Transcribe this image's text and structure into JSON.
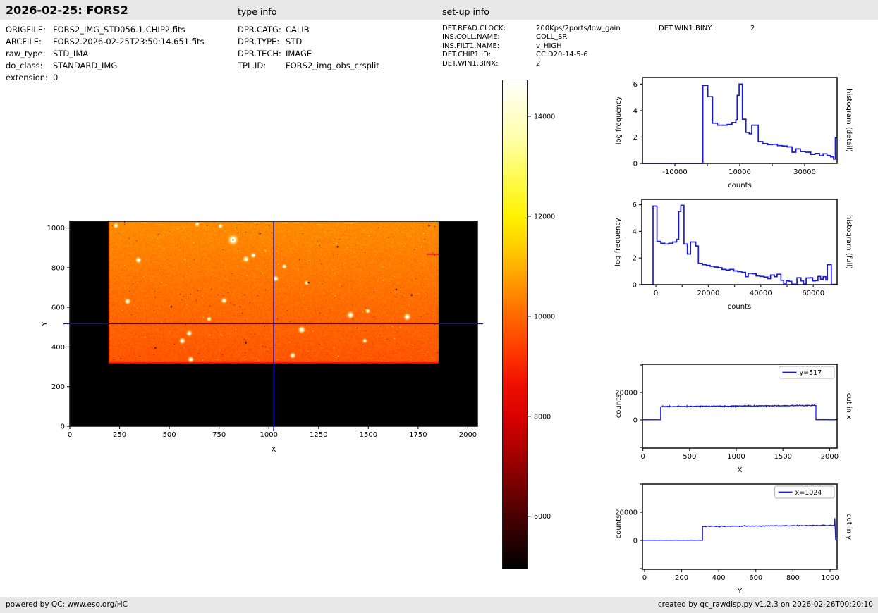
{
  "header": {
    "title": "2026-02-25: FORS2",
    "type_info": "type info",
    "setup_info": "set-up info"
  },
  "file_info": {
    "rows": [
      {
        "label": "ORIGFILE:",
        "value": "FORS2_IMG_STD056.1.CHIP2.fits"
      },
      {
        "label": "ARCFILE:",
        "value": "FORS2.2026-02-25T23:50:14.651.fits"
      },
      {
        "label": "raw_type:",
        "value": "STD_IMA"
      },
      {
        "label": "do_class:",
        "value": "STANDARD_IMG"
      },
      {
        "label": "extension:",
        "value": "0"
      }
    ]
  },
  "type_info": {
    "rows": [
      {
        "label": "DPR.CATG:",
        "value": "CALIB"
      },
      {
        "label": "DPR.TYPE:",
        "value": "STD"
      },
      {
        "label": "DPR.TECH:",
        "value": "IMAGE"
      },
      {
        "label": "TPL.ID:",
        "value": "FORS2_img_obs_crsplit"
      }
    ]
  },
  "setup_info": {
    "rows": [
      {
        "label": "DET.READ.CLOCK:",
        "value": "200Kps/2ports/low_gain"
      },
      {
        "label": "INS.COLL.NAME:",
        "value": "COLL_SR"
      },
      {
        "label": "INS.FILT1.NAME:",
        "value": "v_HIGH"
      },
      {
        "label": "DET.CHIP1.ID:",
        "value": "CCID20-14-5-6"
      },
      {
        "label": "DET.WIN1.BINX:",
        "value": "2"
      }
    ],
    "rows_col2": [
      {
        "label": "DET.WIN1.BINY:",
        "value": "2"
      }
    ]
  },
  "footer": {
    "left": "powered by QC: www.eso.org/HC",
    "right": "created by qc_rawdisp.py v1.2.3 on 2026-02-26T00:20:10"
  },
  "colors": {
    "line_blue": "#1a1adc",
    "crosshair_blue": "#0000ff",
    "frame": "#1a1a1a",
    "header_bg": "#e8e8e8",
    "image_orange": "#ff6a00",
    "trail_red": "#d40000",
    "legend_border": "#b0b0b0"
  },
  "chart_data": [
    {
      "id": "main_image",
      "type": "heatmap",
      "xlabel": "X",
      "ylabel": "Y",
      "xlim": [
        0,
        2048
      ],
      "ylim": [
        0,
        1034
      ],
      "xticks": [
        0,
        250,
        500,
        750,
        1000,
        1250,
        1500,
        1750,
        2000
      ],
      "yticks": [
        0,
        200,
        400,
        600,
        800,
        1000
      ],
      "crosshair": {
        "x": 1024,
        "y": 517
      },
      "illuminated_region": {
        "x0": 195,
        "x1": 1852,
        "y0": 318,
        "y1": 1034
      },
      "counts_levels": {
        "plateau_bottom": 9700,
        "plateau_top": 10500,
        "vmin": 4940,
        "vmax": 14730
      },
      "stars": [
        [
          820,
          940,
          3
        ],
        [
          345,
          838,
          1.5
        ],
        [
          885,
          843,
          1.5
        ],
        [
          922,
          862,
          1.2
        ],
        [
          1078,
          806,
          1
        ],
        [
          1035,
          745,
          1.3
        ],
        [
          1190,
          723,
          1
        ],
        [
          290,
          630,
          1.4
        ],
        [
          775,
          634,
          1.3
        ],
        [
          700,
          541,
          1
        ],
        [
          1410,
          561,
          1.8
        ],
        [
          1695,
          552,
          1.8
        ],
        [
          1497,
          581,
          1
        ],
        [
          1165,
          487,
          1.8
        ],
        [
          600,
          469,
          1.4
        ],
        [
          565,
          431,
          1.5
        ],
        [
          1482,
          431,
          1
        ],
        [
          1120,
          357,
          1.3
        ],
        [
          608,
          337,
          1.4
        ],
        [
          232,
          1012,
          1.2
        ],
        [
          640,
          1018,
          1
        ],
        [
          757,
          1010,
          1
        ]
      ],
      "dark_specks": [
        [
          1805,
          1012
        ],
        [
          1640,
          690
        ],
        [
          1200,
          725
        ],
        [
          430,
          395
        ],
        [
          955,
          972
        ],
        [
          1718,
          662
        ],
        [
          1345,
          905
        ],
        [
          510,
          603
        ],
        [
          885,
          420
        ]
      ],
      "red_trail": {
        "y": 868,
        "x0": 1792,
        "x1": 1860
      }
    },
    {
      "id": "colorbar",
      "type": "colorbar",
      "colormap": "hot",
      "vmin": 4940,
      "vmax": 14730,
      "ticks": [
        14000,
        12000,
        10000,
        8000,
        6000
      ]
    },
    {
      "id": "hist_detail",
      "type": "step-histogram",
      "right_label": "histogram (detail)",
      "xlabel": "counts",
      "ylabel": "log frequency",
      "xlim": [
        -20000,
        40000
      ],
      "ylim": [
        0,
        6.5
      ],
      "xticks": [
        [
          -10000,
          "-10000"
        ],
        [
          0,
          null
        ],
        [
          10000,
          "10000"
        ],
        [
          20000,
          null
        ],
        [
          30000,
          "30000"
        ]
      ],
      "yticks": [
        [
          0,
          "0"
        ],
        [
          2,
          "2"
        ],
        [
          4,
          "4"
        ],
        [
          6,
          "6"
        ]
      ],
      "steps": [
        [
          -20000,
          0
        ],
        [
          -1400,
          5.9
        ],
        [
          150,
          5.05
        ],
        [
          1600,
          3.05
        ],
        [
          3100,
          2.9
        ],
        [
          4600,
          2.9
        ],
        [
          6100,
          2.95
        ],
        [
          7600,
          3.1
        ],
        [
          8800,
          3.3
        ],
        [
          9200,
          5.15
        ],
        [
          9800,
          6.0
        ],
        [
          10800,
          3.35
        ],
        [
          11900,
          2.35
        ],
        [
          12900,
          2.25
        ],
        [
          13700,
          2.9
        ],
        [
          15700,
          1.65
        ],
        [
          17100,
          1.5
        ],
        [
          18600,
          1.42
        ],
        [
          20100,
          1.45
        ],
        [
          21600,
          1.35
        ],
        [
          23100,
          1.32
        ],
        [
          24600,
          1.25
        ],
        [
          26100,
          0.85
        ],
        [
          27300,
          1.1
        ],
        [
          28700,
          0.9
        ],
        [
          30300,
          0.85
        ],
        [
          31900,
          0.68
        ],
        [
          33200,
          0.75
        ],
        [
          34600,
          0.58
        ],
        [
          35700,
          0.73
        ],
        [
          36900,
          0.6
        ],
        [
          38000,
          0.5
        ],
        [
          38900,
          0.33
        ],
        [
          39450,
          1.95
        ]
      ]
    },
    {
      "id": "hist_full",
      "type": "step-histogram",
      "right_label": "histogram (full)",
      "xlabel": "counts",
      "ylabel": "log frequency",
      "xlim": [
        -5400,
        69100
      ],
      "ylim": [
        0,
        6.4
      ],
      "xticks": [
        [
          0,
          "0"
        ],
        [
          10000,
          null
        ],
        [
          20000,
          "20000"
        ],
        [
          30000,
          null
        ],
        [
          40000,
          "40000"
        ],
        [
          50000,
          null
        ],
        [
          60000,
          "60000"
        ]
      ],
      "yticks": [
        [
          0,
          "0"
        ],
        [
          2,
          "2"
        ],
        [
          4,
          "4"
        ],
        [
          6,
          "6"
        ]
      ],
      "steps": [
        [
          -5400,
          0
        ],
        [
          -1100,
          5.9
        ],
        [
          400,
          3.25
        ],
        [
          1900,
          3.1
        ],
        [
          3400,
          3.05
        ],
        [
          4900,
          3.1
        ],
        [
          6400,
          3.2
        ],
        [
          7900,
          3.4
        ],
        [
          8700,
          5.5
        ],
        [
          9500,
          5.95
        ],
        [
          10700,
          3.05
        ],
        [
          12000,
          2.3
        ],
        [
          13200,
          3.2
        ],
        [
          15200,
          2.9
        ],
        [
          16200,
          1.6
        ],
        [
          17700,
          1.5
        ],
        [
          19200,
          1.45
        ],
        [
          20700,
          1.38
        ],
        [
          22200,
          1.32
        ],
        [
          23700,
          1.27
        ],
        [
          25200,
          1.15
        ],
        [
          26700,
          1.1
        ],
        [
          28200,
          1.15
        ],
        [
          29700,
          1.03
        ],
        [
          31200,
          0.98
        ],
        [
          32700,
          0.92
        ],
        [
          34200,
          0.6
        ],
        [
          35200,
          0.85
        ],
        [
          36700,
          0.82
        ],
        [
          38200,
          0.65
        ],
        [
          39700,
          0.62
        ],
        [
          41200,
          0.57
        ],
        [
          42700,
          0.45
        ],
        [
          43700,
          0.72
        ],
        [
          45200,
          0.6
        ],
        [
          46200,
          0.78
        ],
        [
          47700,
          0.33
        ],
        [
          48700,
          0.05
        ],
        [
          49700,
          0.28
        ],
        [
          50800,
          0.25
        ],
        [
          51800,
          0.03
        ],
        [
          53800,
          0.52
        ],
        [
          55300,
          0.28
        ],
        [
          56300,
          0.05
        ],
        [
          57300,
          0.5
        ],
        [
          58800,
          0.52
        ],
        [
          59800,
          0.28
        ],
        [
          60800,
          0.3
        ],
        [
          61800,
          0.62
        ],
        [
          62800,
          0.4
        ],
        [
          63800,
          0.6
        ],
        [
          64800,
          0.35
        ],
        [
          65400,
          1.5
        ],
        [
          66900,
          0.02
        ]
      ]
    },
    {
      "id": "cut_x",
      "type": "line",
      "legend": "y=517",
      "right_label": "cut in x",
      "xlabel": "X",
      "ylabel": "counts",
      "xlim": [
        -5,
        2080
      ],
      "ylim": [
        -20500,
        40500
      ],
      "xticks": [
        [
          0,
          "0"
        ],
        [
          500,
          "500"
        ],
        [
          1000,
          "1000"
        ],
        [
          1500,
          "1500"
        ],
        [
          2000,
          "2000"
        ]
      ],
      "yticks": [
        [
          -20000,
          null
        ],
        [
          0,
          "0"
        ],
        [
          20000,
          "20000"
        ],
        [
          40000,
          null
        ]
      ],
      "profile": {
        "segments": [
          {
            "x0": -5,
            "x1": 190,
            "y0": 120,
            "y1": 120,
            "noise": 140
          },
          {
            "x0": 190,
            "x1": 1853,
            "y0": 9700,
            "y1": 10500,
            "noise": 480
          },
          {
            "x0": 1853,
            "x1": 2080,
            "y0": 150,
            "y1": 120,
            "noise": 140
          }
        ]
      }
    },
    {
      "id": "cut_y",
      "type": "line",
      "legend": "x=1024",
      "right_label": "cut in y",
      "xlabel": "Y",
      "ylabel": "counts",
      "xlim": [
        -11,
        1038
      ],
      "ylim": [
        -20500,
        40000
      ],
      "xticks": [
        [
          0,
          "0"
        ],
        [
          200,
          "200"
        ],
        [
          400,
          "400"
        ],
        [
          600,
          "600"
        ],
        [
          800,
          "800"
        ],
        [
          1000,
          "1000"
        ]
      ],
      "yticks": [
        [
          -20000,
          null
        ],
        [
          0,
          "0"
        ],
        [
          20000,
          "20000"
        ],
        [
          40000,
          null
        ]
      ],
      "profile": {
        "segments": [
          {
            "x0": -11,
            "x1": 313,
            "y0": 100,
            "y1": 100,
            "noise": 120
          },
          {
            "x0": 313,
            "x1": 1023,
            "y0": 9900,
            "y1": 10700,
            "noise": 450
          },
          {
            "x0": 1023,
            "x1": 1026,
            "y0": 10700,
            "y1": 15800,
            "noise": 150
          },
          {
            "x0": 1026,
            "x1": 1030,
            "y0": 15800,
            "y1": 60,
            "noise": 0
          },
          {
            "x0": 1030,
            "x1": 1038,
            "y0": 60,
            "y1": 60,
            "noise": 80
          }
        ]
      }
    }
  ]
}
